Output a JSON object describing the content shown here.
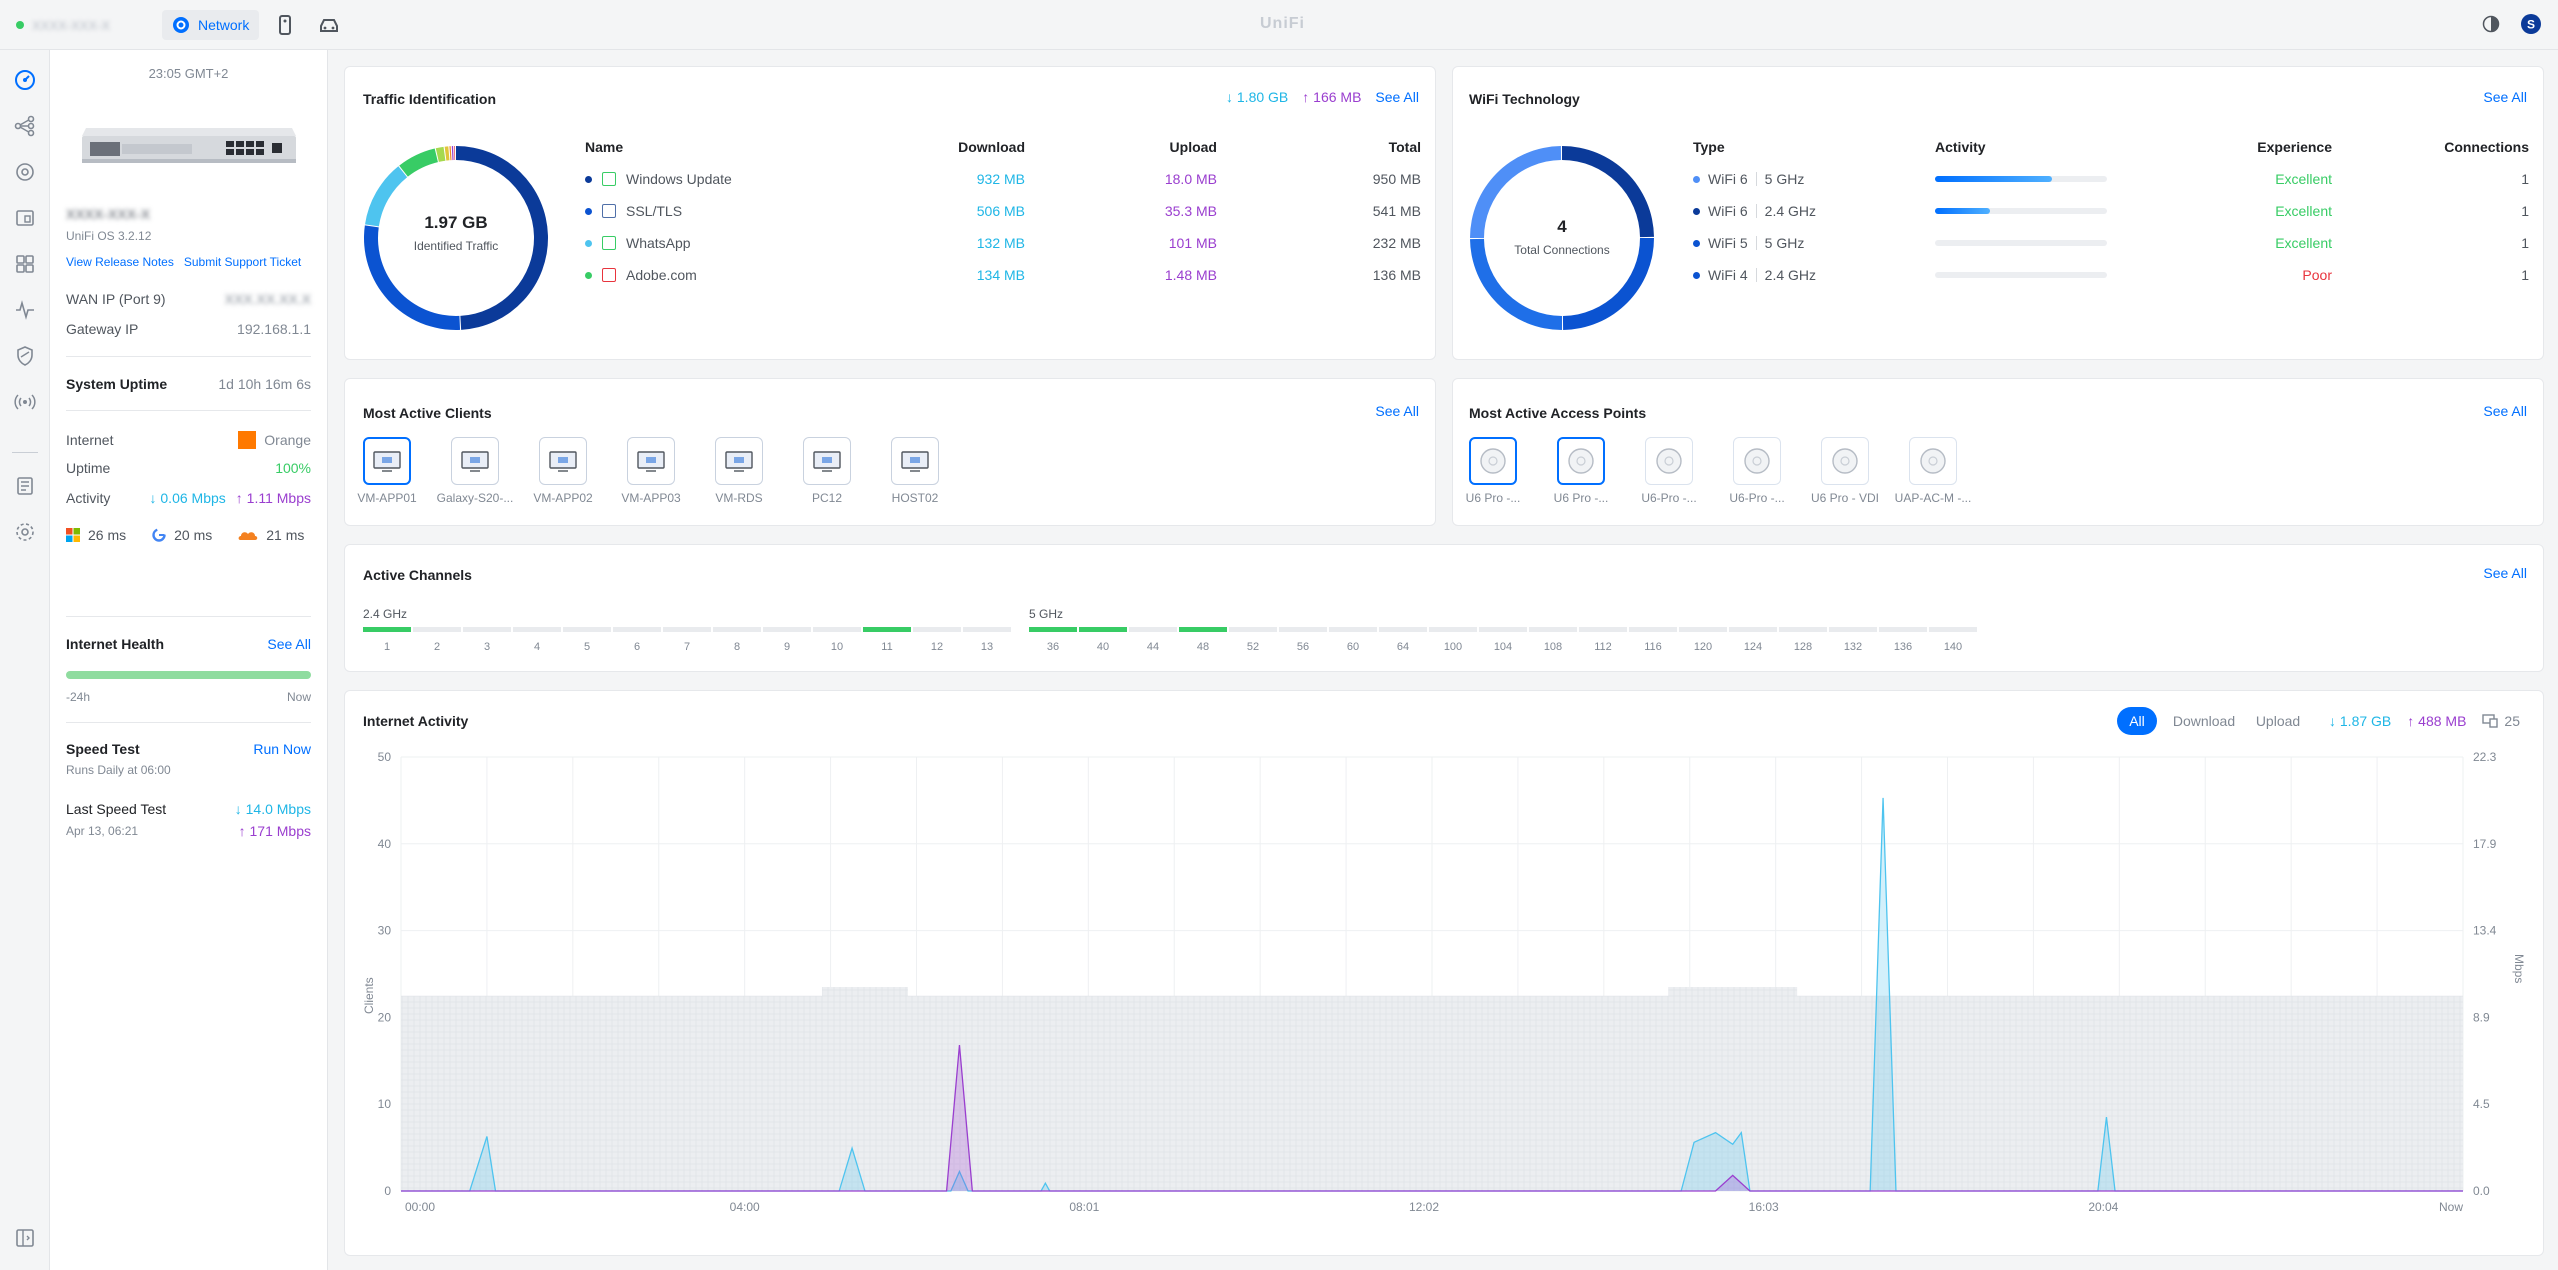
{
  "topbar": {
    "site_name": "XXXX-XXX-X",
    "app_name": "Network",
    "brand": "UniFi"
  },
  "device": {
    "time": "23:05 GMT+2",
    "name": "XXXX-XXX-X",
    "os": "UniFi OS 3.2.12",
    "release_notes": "View Release Notes",
    "support": "Submit Support Ticket",
    "wan_label": "WAN IP (Port 9)",
    "wan_value": "XXX.XX.XX.X",
    "gateway_label": "Gateway IP",
    "gateway_value": "192.168.1.1",
    "uptime_label": "System Uptime",
    "uptime_value": "1d 10h 16m 6s",
    "internet_label": "Internet",
    "internet_value": "Orange",
    "uptime2_label": "Uptime",
    "uptime2_value": "100%",
    "activity_label": "Activity",
    "activity_down": "↓ 0.06 Mbps",
    "activity_up": "↑ 1.11 Mbps",
    "latency": [
      {
        "icon": "microsoft-icon",
        "value": "26 ms"
      },
      {
        "icon": "google-icon",
        "value": "20 ms"
      },
      {
        "icon": "cloudflare-icon",
        "value": "21 ms"
      }
    ],
    "health_label": "Internet Health",
    "health_see_all": "See All",
    "health_start": "-24h",
    "health_end": "Now",
    "speedtest_label": "Speed Test",
    "speedtest_run": "Run Now",
    "speedtest_schedule": "Runs Daily at 06:00",
    "last_speedtest_label": "Last Speed Test",
    "last_speedtest_date": "Apr 13, 06:21",
    "last_speedtest_down": "↓ 14.0 Mbps",
    "last_speedtest_up": "↑ 171 Mbps"
  },
  "traffic": {
    "title": "Traffic Identification",
    "down_total": "↓ 1.80 GB",
    "up_total": "↑ 166 MB",
    "see_all": "See All",
    "center_value": "1.97 GB",
    "center_label": "Identified Traffic",
    "headers": [
      "Name",
      "Download",
      "Upload",
      "Total"
    ],
    "rows": [
      {
        "name": "Windows Update",
        "download": "932 MB",
        "upload": "18.0 MB",
        "total": "950 MB",
        "color": "#0b3a99"
      },
      {
        "name": "SSL/TLS",
        "download": "506 MB",
        "upload": "35.3 MB",
        "total": "541 MB",
        "color": "#0b53d1"
      },
      {
        "name": "WhatsApp",
        "download": "132 MB",
        "upload": "101 MB",
        "total": "232 MB",
        "color": "#4ec4ef"
      },
      {
        "name": "Adobe.com",
        "download": "134 MB",
        "upload": "1.48 MB",
        "total": "136 MB",
        "color": "#38cc65"
      }
    ]
  },
  "wifi": {
    "title": "WiFi Technology",
    "see_all": "See All",
    "center_value": "4",
    "center_label": "Total Connections",
    "headers": [
      "Type",
      "Activity",
      "Experience",
      "Connections"
    ],
    "rows": [
      {
        "type": "WiFi 6",
        "band": "5 GHz",
        "activity": 0.68,
        "experience": "Excellent",
        "connections": "1",
        "color": "#4f8ff7",
        "exp_color": "#38cc65"
      },
      {
        "type": "WiFi 6",
        "band": "2.4 GHz",
        "activity": 0.32,
        "experience": "Excellent",
        "connections": "1",
        "color": "#0b3a99",
        "exp_color": "#38cc65"
      },
      {
        "type": "WiFi 5",
        "band": "5 GHz",
        "activity": 0,
        "experience": "Excellent",
        "connections": "1",
        "color": "#0b53d1",
        "exp_color": "#38cc65"
      },
      {
        "type": "WiFi 4",
        "band": "2.4 GHz",
        "activity": 0,
        "experience": "Poor",
        "connections": "1",
        "color": "#0b53d1",
        "exp_color": "#e8343d"
      }
    ]
  },
  "clients": {
    "title": "Most Active Clients",
    "see_all": "See All",
    "items": [
      "VM-APP01",
      "Galaxy-S20-...",
      "VM-APP02",
      "VM-APP03",
      "VM-RDS",
      "PC12",
      "HOST02"
    ]
  },
  "aps": {
    "title": "Most Active Access Points",
    "see_all": "See All",
    "items": [
      "U6 Pro -...",
      "U6 Pro -...",
      "U6-Pro -...",
      "U6-Pro -...",
      "U6 Pro - VDI",
      "UAP-AC-M -..."
    ]
  },
  "channels": {
    "title": "Active Channels",
    "see_all": "See All",
    "band24": "2.4 GHz",
    "band5": "5 GHz",
    "ch24": [
      "1",
      "2",
      "3",
      "4",
      "5",
      "6",
      "7",
      "8",
      "9",
      "10",
      "11",
      "12",
      "13"
    ],
    "ch24_active": [
      0,
      10
    ],
    "ch5": [
      "36",
      "40",
      "44",
      "48",
      "52",
      "56",
      "60",
      "64",
      "100",
      "104",
      "108",
      "112",
      "116",
      "120",
      "124",
      "128",
      "132",
      "136",
      "140"
    ],
    "ch5_active": [
      0,
      1,
      3
    ]
  },
  "activity": {
    "title": "Internet Activity",
    "filters": [
      "All",
      "Download",
      "Upload"
    ],
    "down_total": "↓ 1.87 GB",
    "up_total": "↑ 488 MB",
    "clients_count": "25"
  },
  "chart_data": {
    "type": "area",
    "title": "Internet Activity",
    "xlabel": "",
    "ylabel": "Clients",
    "y2label": "Mbps",
    "x_ticks": [
      "00:00",
      "04:00",
      "08:01",
      "12:02",
      "16:03",
      "20:04",
      "Now"
    ],
    "y_ticks": [
      0,
      10,
      20,
      30,
      40,
      50
    ],
    "y2_ticks": [
      "0.0",
      "4.5",
      "8.9",
      "13.4",
      "17.9",
      "22.3"
    ],
    "ylim": [
      0,
      50
    ],
    "y2lim": [
      0,
      22.3
    ],
    "x_range_hours": [
      0,
      24
    ],
    "clients": [
      {
        "t": 0,
        "v": 22.5
      },
      {
        "t": 4.9,
        "v": 22.5
      },
      {
        "t": 4.9,
        "v": 23.5
      },
      {
        "t": 5.9,
        "v": 23.5
      },
      {
        "t": 5.9,
        "v": 22.5
      },
      {
        "t": 14.75,
        "v": 22.5
      },
      {
        "t": 14.75,
        "v": 23.5
      },
      {
        "t": 16.25,
        "v": 23.5
      },
      {
        "t": 16.25,
        "v": 22.5
      },
      {
        "t": 24,
        "v": 22.5
      }
    ],
    "series": [
      {
        "name": "Download",
        "color": "#4ec4ef",
        "points": [
          [
            0,
            0
          ],
          [
            0.8,
            0
          ],
          [
            1,
            2.8
          ],
          [
            1.1,
            0
          ],
          [
            5.1,
            0
          ],
          [
            5.25,
            2.2
          ],
          [
            5.4,
            0
          ],
          [
            6.4,
            0
          ],
          [
            6.5,
            1.0
          ],
          [
            6.6,
            0
          ],
          [
            7.45,
            0
          ],
          [
            7.5,
            0.4
          ],
          [
            7.55,
            0
          ],
          [
            14.9,
            0
          ],
          [
            15.05,
            2.5
          ],
          [
            15.3,
            3.0
          ],
          [
            15.5,
            2.4
          ],
          [
            15.6,
            3.0
          ],
          [
            15.7,
            0
          ],
          [
            17.1,
            0
          ],
          [
            17.25,
            20.2
          ],
          [
            17.4,
            0
          ],
          [
            19.75,
            0
          ],
          [
            19.85,
            3.8
          ],
          [
            19.95,
            0
          ],
          [
            24,
            0
          ]
        ]
      },
      {
        "name": "Upload",
        "color": "#9a3ecf",
        "points": [
          [
            0,
            0
          ],
          [
            6.35,
            0
          ],
          [
            6.5,
            7.5
          ],
          [
            6.65,
            0
          ],
          [
            15.3,
            0
          ],
          [
            15.5,
            0.8
          ],
          [
            15.7,
            0
          ],
          [
            24,
            0
          ]
        ]
      }
    ],
    "grid": true
  }
}
